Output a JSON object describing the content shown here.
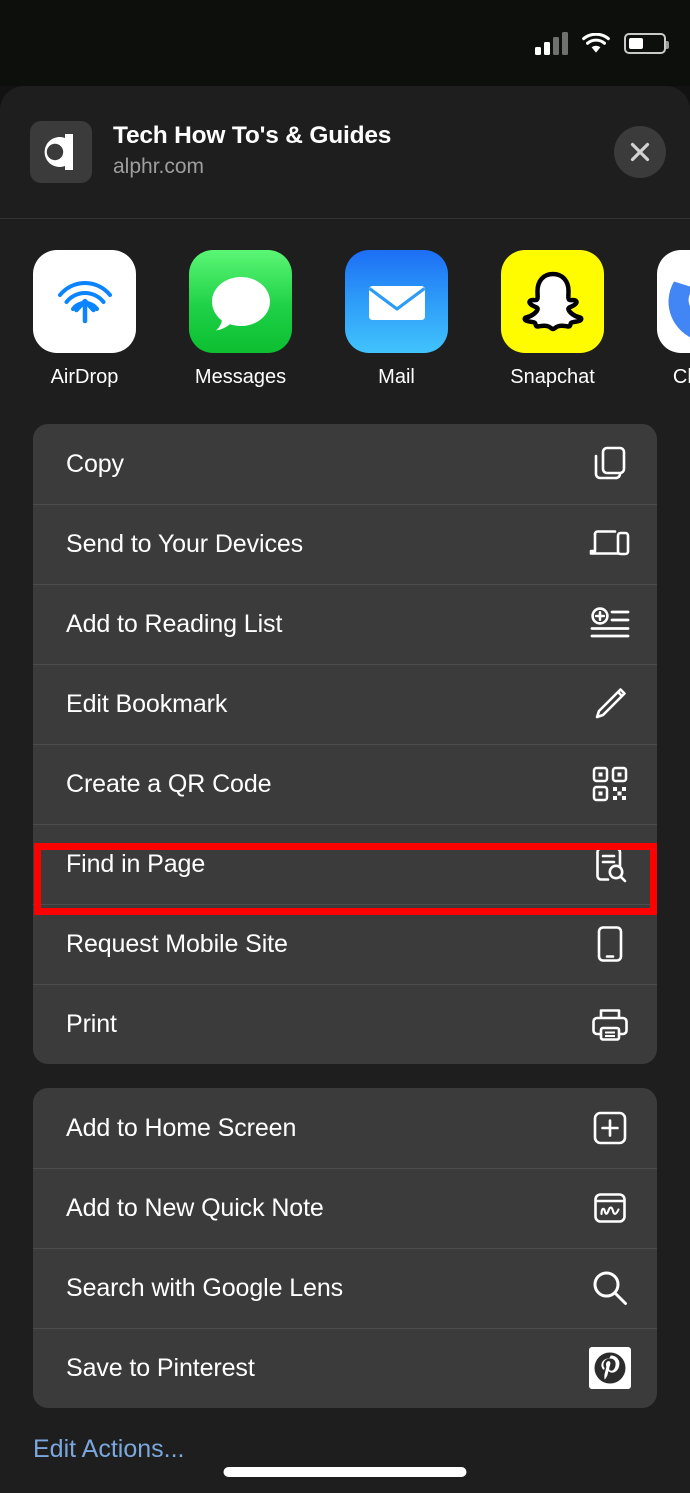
{
  "status_bar": {
    "signal_icon": "cellular-signal-icon",
    "signal_bars_filled": 2,
    "signal_bars_total": 4,
    "wifi_icon": "wifi-icon",
    "battery_icon": "battery-icon",
    "battery_level_percent": 40
  },
  "header": {
    "favicon": "alphr-favicon",
    "title": "Tech How To's & Guides",
    "subtitle": "alphr.com",
    "close_icon": "close-icon"
  },
  "apps": [
    {
      "label": "AirDrop",
      "icon": "airdrop-icon",
      "color": "#007AFF"
    },
    {
      "label": "Messages",
      "icon": "messages-icon",
      "color": "#1FD147"
    },
    {
      "label": "Mail",
      "icon": "mail-icon",
      "color": "#2D9BF8"
    },
    {
      "label": "Snapchat",
      "icon": "snapchat-icon",
      "color": "#FFFC00"
    },
    {
      "label": "Chrome",
      "icon": "chrome-icon",
      "color": "#FFFFFF"
    }
  ],
  "groups": [
    {
      "items": [
        {
          "label": "Copy",
          "icon": "copy-icon"
        },
        {
          "label": "Send to Your Devices",
          "icon": "devices-icon"
        },
        {
          "label": "Add to Reading List",
          "icon": "reading-list-icon"
        },
        {
          "label": "Edit Bookmark",
          "icon": "pencil-icon"
        },
        {
          "label": "Create a QR Code",
          "icon": "qr-code-icon"
        },
        {
          "label": "Find in Page",
          "icon": "find-in-page-icon"
        },
        {
          "label": "Request Mobile Site",
          "icon": "mobile-site-icon"
        },
        {
          "label": "Print",
          "icon": "printer-icon"
        }
      ]
    },
    {
      "items": [
        {
          "label": "Add to Home Screen",
          "icon": "add-square-icon"
        },
        {
          "label": "Add to New Quick Note",
          "icon": "quick-note-icon"
        },
        {
          "label": "Search with Google Lens",
          "icon": "magnifier-icon"
        },
        {
          "label": "Save to Pinterest",
          "icon": "pinterest-icon"
        }
      ]
    }
  ],
  "footer": {
    "edit_actions_label": "Edit Actions...",
    "edit_actions_color": "#7BA7DD"
  },
  "annotation": {
    "highlight_target": "Find in Page",
    "highlight_color": "#FF0000"
  }
}
